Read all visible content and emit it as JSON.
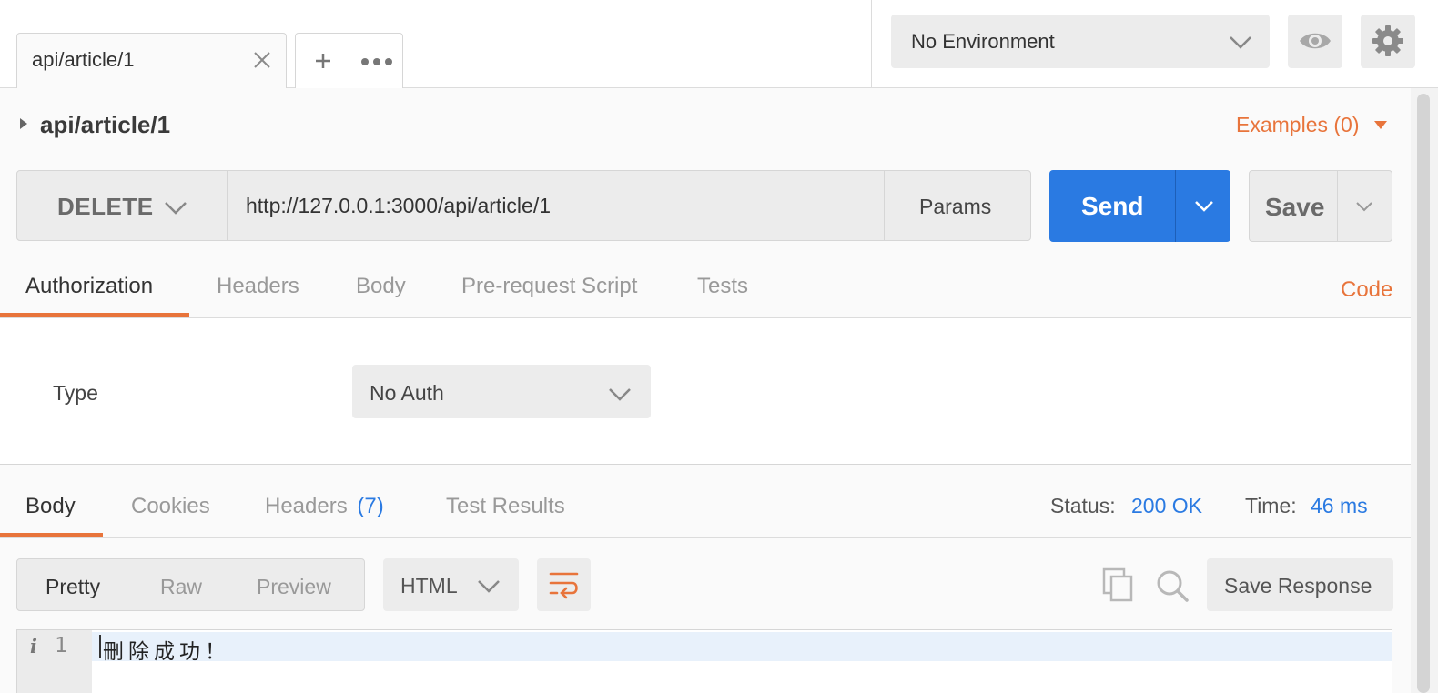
{
  "tabs": {
    "active_label": "api/article/1"
  },
  "environment": {
    "selected": "No Environment"
  },
  "request": {
    "name": "api/article/1",
    "examples_label": "Examples (0)",
    "method": "DELETE",
    "url": "http://127.0.0.1:3000/api/article/1",
    "params_label": "Params",
    "send_label": "Send",
    "save_label": "Save",
    "tabs": [
      "Authorization",
      "Headers",
      "Body",
      "Pre-request Script",
      "Tests"
    ],
    "active_tab": "Authorization",
    "code_label": "Code"
  },
  "auth": {
    "type_label": "Type",
    "selected": "No Auth"
  },
  "response": {
    "tabs": {
      "body": "Body",
      "cookies": "Cookies",
      "headers": "Headers",
      "headers_count": "(7)",
      "test_results": "Test Results"
    },
    "active_tab": "Body",
    "status_label": "Status:",
    "status_value": "200 OK",
    "time_label": "Time:",
    "time_value": "46 ms",
    "view_modes": [
      "Pretty",
      "Raw",
      "Preview"
    ],
    "active_view": "Pretty",
    "format": "HTML",
    "save_response_label": "Save Response",
    "lines": [
      {
        "number": "1",
        "text": "刪除成功！"
      }
    ]
  },
  "colors": {
    "accent": "#e8743b",
    "primary": "#2a7ae2",
    "panel": "#fafafa",
    "control": "#ececec"
  },
  "icons": [
    "close-icon",
    "plus-icon",
    "more-icon",
    "chevron-down-icon",
    "eye-icon",
    "gear-icon",
    "wrap-lines-icon",
    "copy-icon",
    "search-icon",
    "info-icon"
  ]
}
